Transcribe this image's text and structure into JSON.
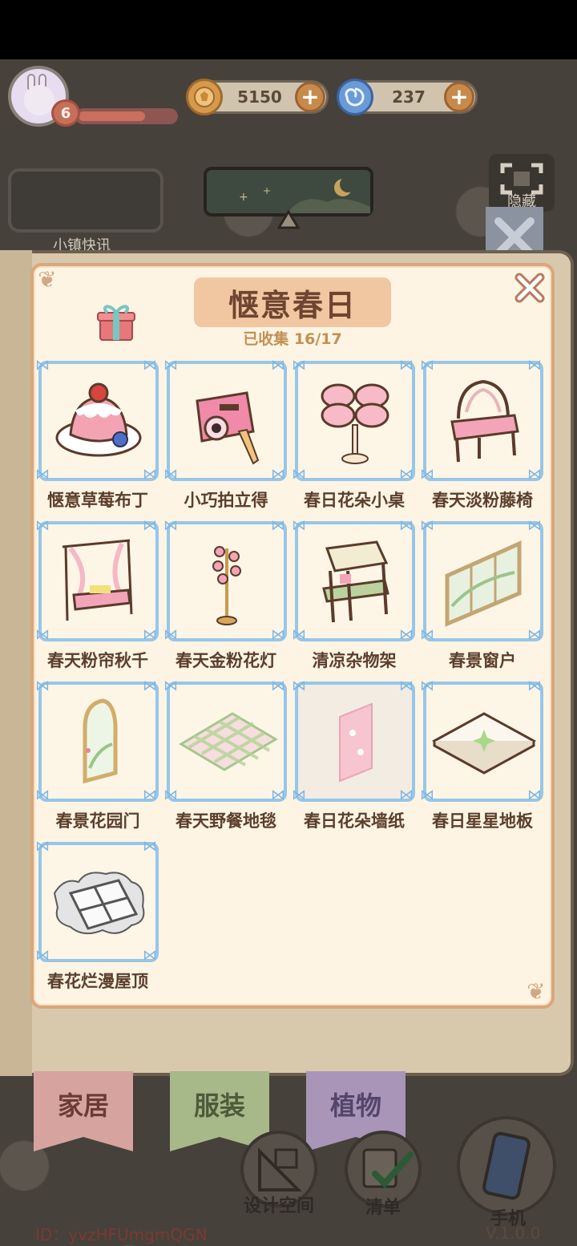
{
  "hud": {
    "level": "6",
    "xp_fraction": 0.69,
    "coins": "5150",
    "gems": "237",
    "news_label": "小镇快讯",
    "hide_label": "隐藏"
  },
  "collection": {
    "title": "惬意春日",
    "collected_label": "已收集 16/17",
    "items": [
      {
        "name": "惬意草莓布丁"
      },
      {
        "name": "小巧拍立得"
      },
      {
        "name": "春日花朵小桌"
      },
      {
        "name": "春天淡粉藤椅"
      },
      {
        "name": "春天粉帘秋千"
      },
      {
        "name": "春天金粉花灯"
      },
      {
        "name": "清凉杂物架"
      },
      {
        "name": "春景窗户"
      },
      {
        "name": "春景花园门"
      },
      {
        "name": "春天野餐地毯"
      },
      {
        "name": "春日花朵墙纸"
      },
      {
        "name": "春日星星地板"
      },
      {
        "name": "春花烂漫屋顶"
      }
    ]
  },
  "tabs": {
    "home": "家居",
    "clothes": "服装",
    "plants": "植物"
  },
  "bottom": {
    "design_space": "设计空间",
    "list": "清单",
    "phone": "手机",
    "id_text": "ID：yvzHFUmgmQGN",
    "version": "V.1.0.0"
  },
  "colors": {
    "modal_bg": "#fdf4e3",
    "cell_border": "#97c6e9",
    "title_bg": "#f1c7a2",
    "title_text": "#6e4530"
  }
}
